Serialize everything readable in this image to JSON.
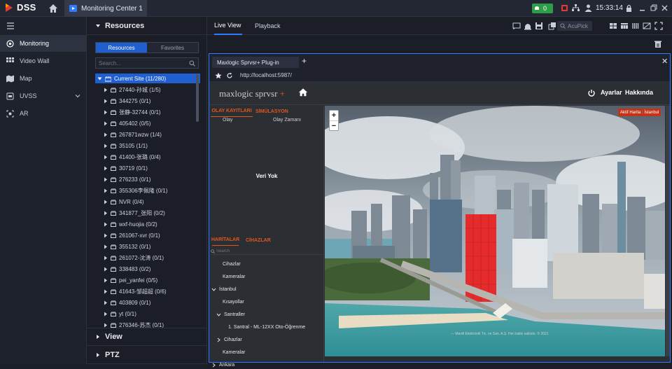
{
  "topbar": {
    "logo": "DSS",
    "tab_title": "Monitoring Center 1",
    "alarm_count": "0",
    "time": "15:33:14"
  },
  "leftnav": {
    "items": [
      {
        "label": "Monitoring",
        "icon": "monitoring-icon"
      },
      {
        "label": "Video Wall",
        "icon": "video-wall-icon"
      },
      {
        "label": "Map",
        "icon": "map-icon"
      },
      {
        "label": "UVSS",
        "icon": "uvss-icon"
      },
      {
        "label": "AR",
        "icon": "ar-icon"
      }
    ],
    "active": "Monitoring"
  },
  "resources": {
    "section_title": "Resources",
    "tabs": [
      "Resources",
      "Favorites"
    ],
    "search_placeholder": "Search...",
    "root_label": "Current Site (11/280)",
    "items": [
      "27440-孙城 (1/5)",
      "344275 (0/1)",
      "张静-32744 (0/1)",
      "405402 (0/5)",
      "267871wzw (1/4)",
      "35105 (1/1)",
      "41400-张璐 (0/4)",
      "30719 (0/1)",
      "276233 (0/1)",
      "355306李佩隆 (0/1)",
      "NVR (0/4)",
      "341877_张阳 (0/2)",
      "wxf-huojia (0/2)",
      "261067-xvr (0/1)",
      "355132 (0/1)",
      "261072-沈涛 (0/1)",
      "338483 (0/2)",
      "pei_yanfei (0/5)",
      "41643-邹超超 (0/6)",
      "403809 (0/1)",
      "yt (0/1)",
      "276346-苏杰 (0/1)"
    ],
    "view_title": "View",
    "ptz_title": "PTZ"
  },
  "main": {
    "tabs": [
      "Live View",
      "Playback"
    ],
    "acupick": "AcuPick"
  },
  "plugin": {
    "tab_title": "Maxlogic Sprvsr+ Plug-in",
    "url": "http://localhost:5987/"
  },
  "app": {
    "brand_main": "maxlogic sprvsr",
    "brand_accent": " +",
    "settings": "Ayarlar",
    "about": "Hakkında",
    "tabs_top": [
      "OLAY KAYITLARI",
      "SİMÜLASYON"
    ],
    "columns": [
      "Olay",
      "Olay Zamanı"
    ],
    "no_data": "Veri Yok",
    "tabs_bottom": [
      "HARİTALAR",
      "CİHAZLAR"
    ],
    "search_placeholder": "Search",
    "tree": [
      {
        "label": "Cihazlar",
        "indent": 1,
        "toggle": ""
      },
      {
        "label": "Kameralar",
        "indent": 1,
        "toggle": ""
      },
      {
        "label": "İstanbul",
        "indent": 0,
        "toggle": "open"
      },
      {
        "label": "Kısayollar",
        "indent": 1,
        "toggle": ""
      },
      {
        "label": "Santraller",
        "indent": 1,
        "toggle": "open"
      },
      {
        "label": "1. Santral - ML-12XX Oto-Öğrenme",
        "indent": 2,
        "toggle": ""
      },
      {
        "label": "Cihazlar",
        "indent": 1,
        "toggle": "closed"
      },
      {
        "label": "Kameralar",
        "indent": 1,
        "toggle": ""
      },
      {
        "label": "Ankara",
        "indent": 0,
        "toggle": "closed"
      }
    ],
    "active_map": "Aktif Harita : İstanbul",
    "copyright": "— Mavili Elektronik Tic. ve San. A.Ş. Her hakkı saklıdır. © 2021"
  },
  "colors": {
    "accent_blue": "#1f5fcf",
    "brand_orange": "#e0581d",
    "highlight_red": "#e52b2b",
    "alarm_green": "#2f9d47"
  }
}
